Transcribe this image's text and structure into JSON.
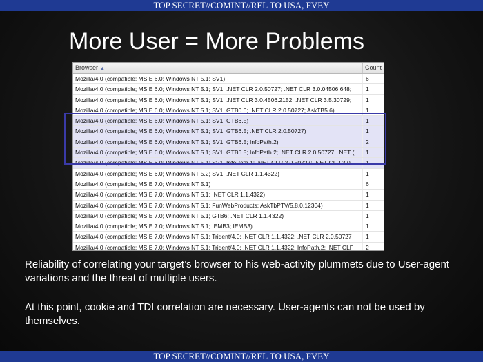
{
  "banner": {
    "top": "TOP SECRET//COMINT//REL TO USA, FVEY",
    "bottom": "TOP SECRET//COMINT//REL TO USA, FVEY"
  },
  "slide": {
    "title": "More User = More Problems"
  },
  "table": {
    "headers": {
      "browser": "Browser",
      "count": "Count"
    },
    "sort_icon": "sort-ascending-icon",
    "rows": [
      {
        "browser": "Mozilla/4.0 (compatible; MSIE 6.0; Windows NT 5.1; SV1)",
        "count": "6",
        "highlight": false
      },
      {
        "browser": "Mozilla/4.0 (compatible; MSIE 6.0; Windows NT 5.1; SV1; .NET CLR 2.0.50727; .NET CLR 3.0.04506.648;",
        "count": "1",
        "highlight": false
      },
      {
        "browser": "Mozilla/4.0 (compatible; MSIE 6.0; Windows NT 5.1; SV1; .NET CLR 3.0.4506.2152; .NET CLR 3.5.30729;",
        "count": "1",
        "highlight": false
      },
      {
        "browser": "Mozilla/4.0 (compatible; MSIE 6.0; Windows NT 5.1; SV1; GTB0.0; .NET CLR 2.0.50727; AskTB5.6)",
        "count": "1",
        "highlight": false
      },
      {
        "browser": "Mozilla/4.0 (compatible; MSIE 6.0; Windows NT 5.1; SV1; GTB6.5)",
        "count": "1",
        "highlight": true
      },
      {
        "browser": "Mozilla/4.0 (compatible; MSIE 6.0; Windows NT 5.1; SV1; GTB6.5; .NET CLR 2.0.50727)",
        "count": "1",
        "highlight": true
      },
      {
        "browser": "Mozilla/4.0 (compatible; MSIE 6.0; Windows NT 5.1; SV1; GTB6.5; InfoPath.2)",
        "count": "2",
        "highlight": true
      },
      {
        "browser": "Mozilla/4.0 (compatible; MSIE 6.0; Windows NT 5.1; SV1; GTB6.5; InfoPath.2; .NET CLR 2.0.50727; .NET (",
        "count": "1",
        "highlight": true
      },
      {
        "browser": "Mozilla/4.0 (compatible; MSIE 6.0; Windows NT 5.1; SV1; InfoPath.1; .NET CLR 2.0.50727; .NET CLR 3.0.",
        "count": "1",
        "highlight": true
      },
      {
        "browser": "Mozilla/4.0 (compatible; MSIE 6.0; Windows NT 5.2; SV1; .NET CLR 1.1.4322)",
        "count": "1",
        "highlight": false
      },
      {
        "browser": "Mozilla/4.0 (compatible; MSIE 7.0; Windows NT 5.1)",
        "count": "6",
        "highlight": false
      },
      {
        "browser": "Mozilla/4.0 (compatible; MSIE 7.0; Windows NT 5.1; .NET CLR 1.1.4322)",
        "count": "1",
        "highlight": false
      },
      {
        "browser": "Mozilla/4.0 (compatible; MSIE 7.0; Windows NT 5.1; FunWebProducts; AskTbPTV/5.8.0.12304)",
        "count": "1",
        "highlight": false
      },
      {
        "browser": "Mozilla/4.0 (compatible; MSIE 7.0; Windows NT 5.1; GTB6; .NET CLR 1.1.4322)",
        "count": "1",
        "highlight": false
      },
      {
        "browser": "Mozilla/4.0 (compatible; MSIE 7.0; Windows NT 5.1; IEMB3; IEMB3)",
        "count": "1",
        "highlight": false
      },
      {
        "browser": "Mozilla/4.0 (compatible; MSIE 7.0; Windows NT 5.1; Trident/4.0; .NET CLR 1.1.4322; .NET CLR 2.0.50727",
        "count": "1",
        "highlight": false
      },
      {
        "browser": "Mozilla/4.0 (compatible; MSIE 7.0; Windows NT 5.1; Trident/4.0; .NET CLR 1.1.4322; InfoPath.2; .NET CLF",
        "count": "2",
        "highlight": false
      }
    ]
  },
  "body_text": {
    "p1": "Reliability of correlating your target’s browser to his web-activity plummets due to User-agent variations and the threat of multiple users.",
    "p2": "At this point, cookie and TDI correlation are necessary. User-agents can not be used by themselves."
  },
  "colors": {
    "banner": "#1f3a93",
    "highlight_border": "#3a3aa8",
    "highlight_fill": "#e3e3f6"
  }
}
